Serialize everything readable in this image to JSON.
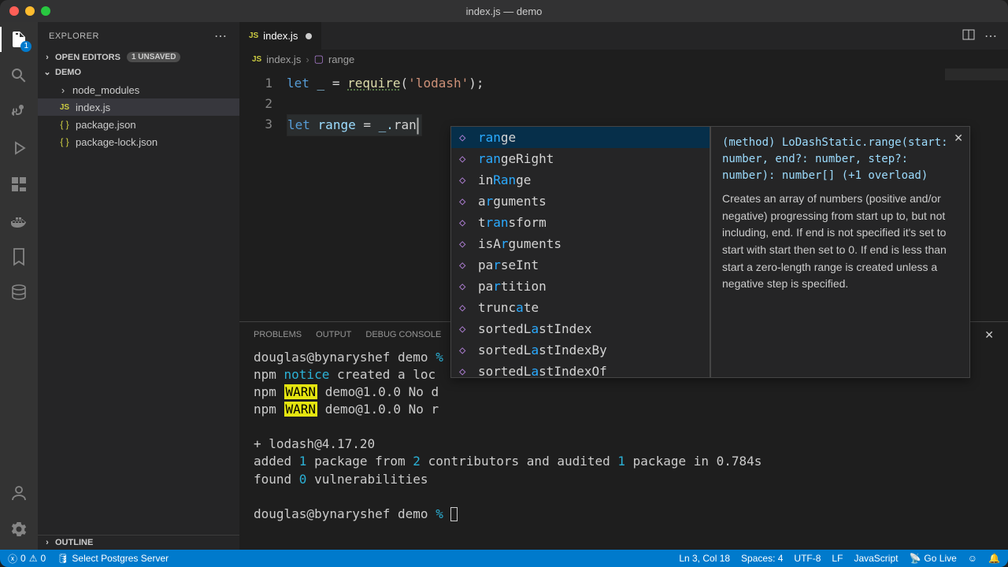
{
  "window": {
    "title": "index.js — demo"
  },
  "sidebar": {
    "title": "EXPLORER",
    "openEditors": {
      "label": "OPEN EDITORS",
      "unsaved": "1 UNSAVED"
    },
    "project": "DEMO",
    "tree": [
      {
        "name": "node_modules",
        "type": "folder"
      },
      {
        "name": "index.js",
        "type": "js",
        "selected": true
      },
      {
        "name": "package.json",
        "type": "json"
      },
      {
        "name": "package-lock.json",
        "type": "json"
      }
    ],
    "outline": "OUTLINE"
  },
  "tabs": {
    "active": {
      "name": "index.js"
    }
  },
  "breadcrumb": {
    "file": "index.js",
    "symbol": "range"
  },
  "editor": {
    "lines": {
      "l1": {
        "let": "let",
        "id": "_",
        "eq": " = ",
        "fn": "require",
        "open": "(",
        "str": "'lodash'",
        "close": ");"
      },
      "l3": {
        "let": "let",
        "id": "range",
        "eq": " = ",
        "rhs": "_.",
        "typed": "ran"
      }
    }
  },
  "suggest": {
    "items": [
      {
        "pre": "",
        "hl": "ran",
        "post": "ge",
        "selected": true
      },
      {
        "pre": "",
        "hl": "ran",
        "post": "geRight"
      },
      {
        "pre": "in",
        "hl": "Ran",
        "post": "ge"
      },
      {
        "pre": "a",
        "hl": "r",
        "post": "guments"
      },
      {
        "pre": "t",
        "hl": "ran",
        "post": "sform"
      },
      {
        "pre": "isA",
        "hl": "r",
        "post": "guments"
      },
      {
        "pre": "pa",
        "hl": "r",
        "post": "seInt"
      },
      {
        "pre": "pa",
        "hl": "r",
        "post": "tition"
      },
      {
        "pre": "trunc",
        "hl": "a",
        "post": "te"
      },
      {
        "pre": "sortedL",
        "hl": "a",
        "post": "stIndex"
      },
      {
        "pre": "sortedL",
        "hl": "a",
        "post": "stIndexBy"
      },
      {
        "pre": "sortedL",
        "hl": "a",
        "post": "stIndexOf"
      }
    ],
    "doc": {
      "sig": "(method) LoDashStatic.range(start: number, end?: number, step?: number): number[] (+1 overload)",
      "body": "Creates an array of numbers (positive and/or negative) progressing from start up to, but not including, end. If end is not specified it's set to start with start then set to 0. If end is less than start a zero-length range is created unless a negative step is specified."
    }
  },
  "panel": {
    "tabs": [
      "PROBLEMS",
      "OUTPUT",
      "DEBUG CONSOLE"
    ],
    "terminal": {
      "l1_a": "douglas@bynaryshef demo ",
      "l1_b": "%",
      "l2_a": "npm ",
      "l2_b": "notice",
      "l2_c": " created a loc",
      "l3_a": "npm ",
      "l3_b": "WARN",
      "l3_c": " demo@1.0.0 No d",
      "l4_a": "npm ",
      "l4_b": "WARN",
      "l4_c": " demo@1.0.0 No r",
      "l5": "",
      "l6": "+ lodash@4.17.20",
      "l7_a": "added ",
      "l7_b": "1",
      "l7_c": " package from ",
      "l7_d": "2",
      "l7_e": " contributors and audited ",
      "l7_f": "1",
      "l7_g": " package in 0.784s",
      "l8_a": "found ",
      "l8_b": "0",
      "l8_c": " vulnerabilities",
      "l9_a": "douglas@bynaryshef demo ",
      "l9_b": "% "
    }
  },
  "statusbar": {
    "errors": "0",
    "warnings": "0",
    "postgres": "Select Postgres Server",
    "lncol": "Ln 3, Col 18",
    "spaces": "Spaces: 4",
    "encoding": "UTF-8",
    "eol": "LF",
    "lang": "JavaScript",
    "golive": "Go Live"
  },
  "activity_badge": "1"
}
